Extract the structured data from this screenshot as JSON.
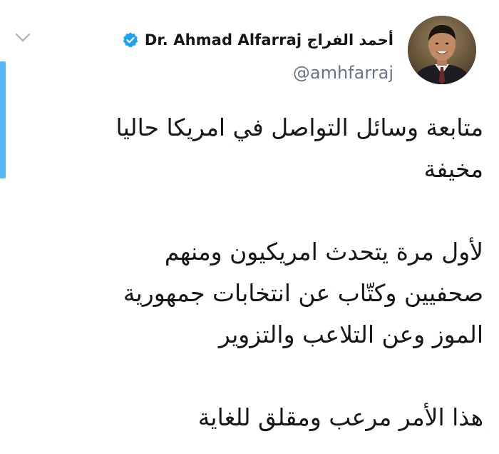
{
  "tweet": {
    "author": {
      "display_name": "Dr. Ahmad Alfarraj أحمد الفراج",
      "handle": "@amhfarraj",
      "verified": true
    },
    "text": {
      "paragraph_1": [
        "متابعة وسائل التواصل في امريكا حاليا",
        "مخيفة"
      ],
      "paragraph_2": [
        "لأول مرة يتحدث امريكيون ومنهم",
        "صحفيين وكتّاب عن انتخابات جمهورية",
        "الموز وعن التلاعب والتزوير"
      ],
      "paragraph_3": [
        "هذا الأمر مرعب ومقلق للغاية"
      ]
    }
  },
  "icons": {
    "menu": "chevron-down-icon",
    "verified": "verified-badge-icon"
  },
  "colors": {
    "accent": "#1da1f2",
    "text": "#14171a",
    "secondary_text": "#657786",
    "chevron": "#aab8c2"
  }
}
